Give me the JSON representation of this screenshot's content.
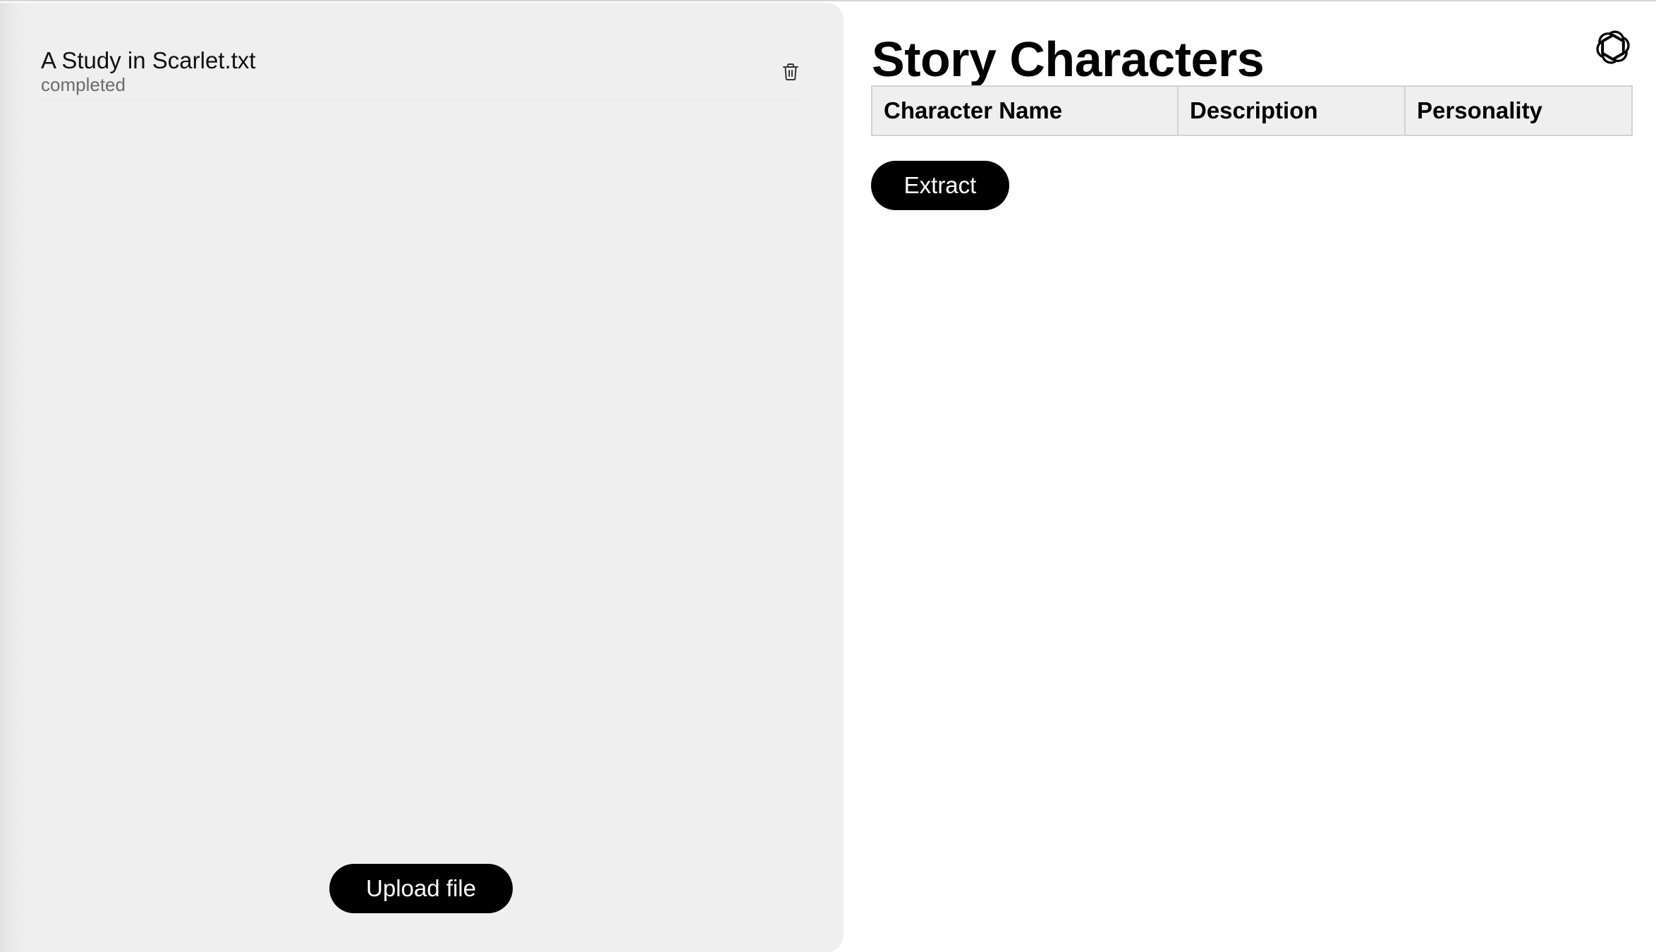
{
  "files": {
    "items": [
      {
        "name": "A Study in Scarlet.txt",
        "status": "completed"
      }
    ],
    "upload_label": "Upload file"
  },
  "main": {
    "title": "Story Characters",
    "table": {
      "columns": [
        "Character Name",
        "Description",
        "Personality"
      ],
      "rows": []
    },
    "extract_label": "Extract"
  },
  "icons": {
    "delete": "trash-icon",
    "logo": "openai-logo-icon"
  }
}
